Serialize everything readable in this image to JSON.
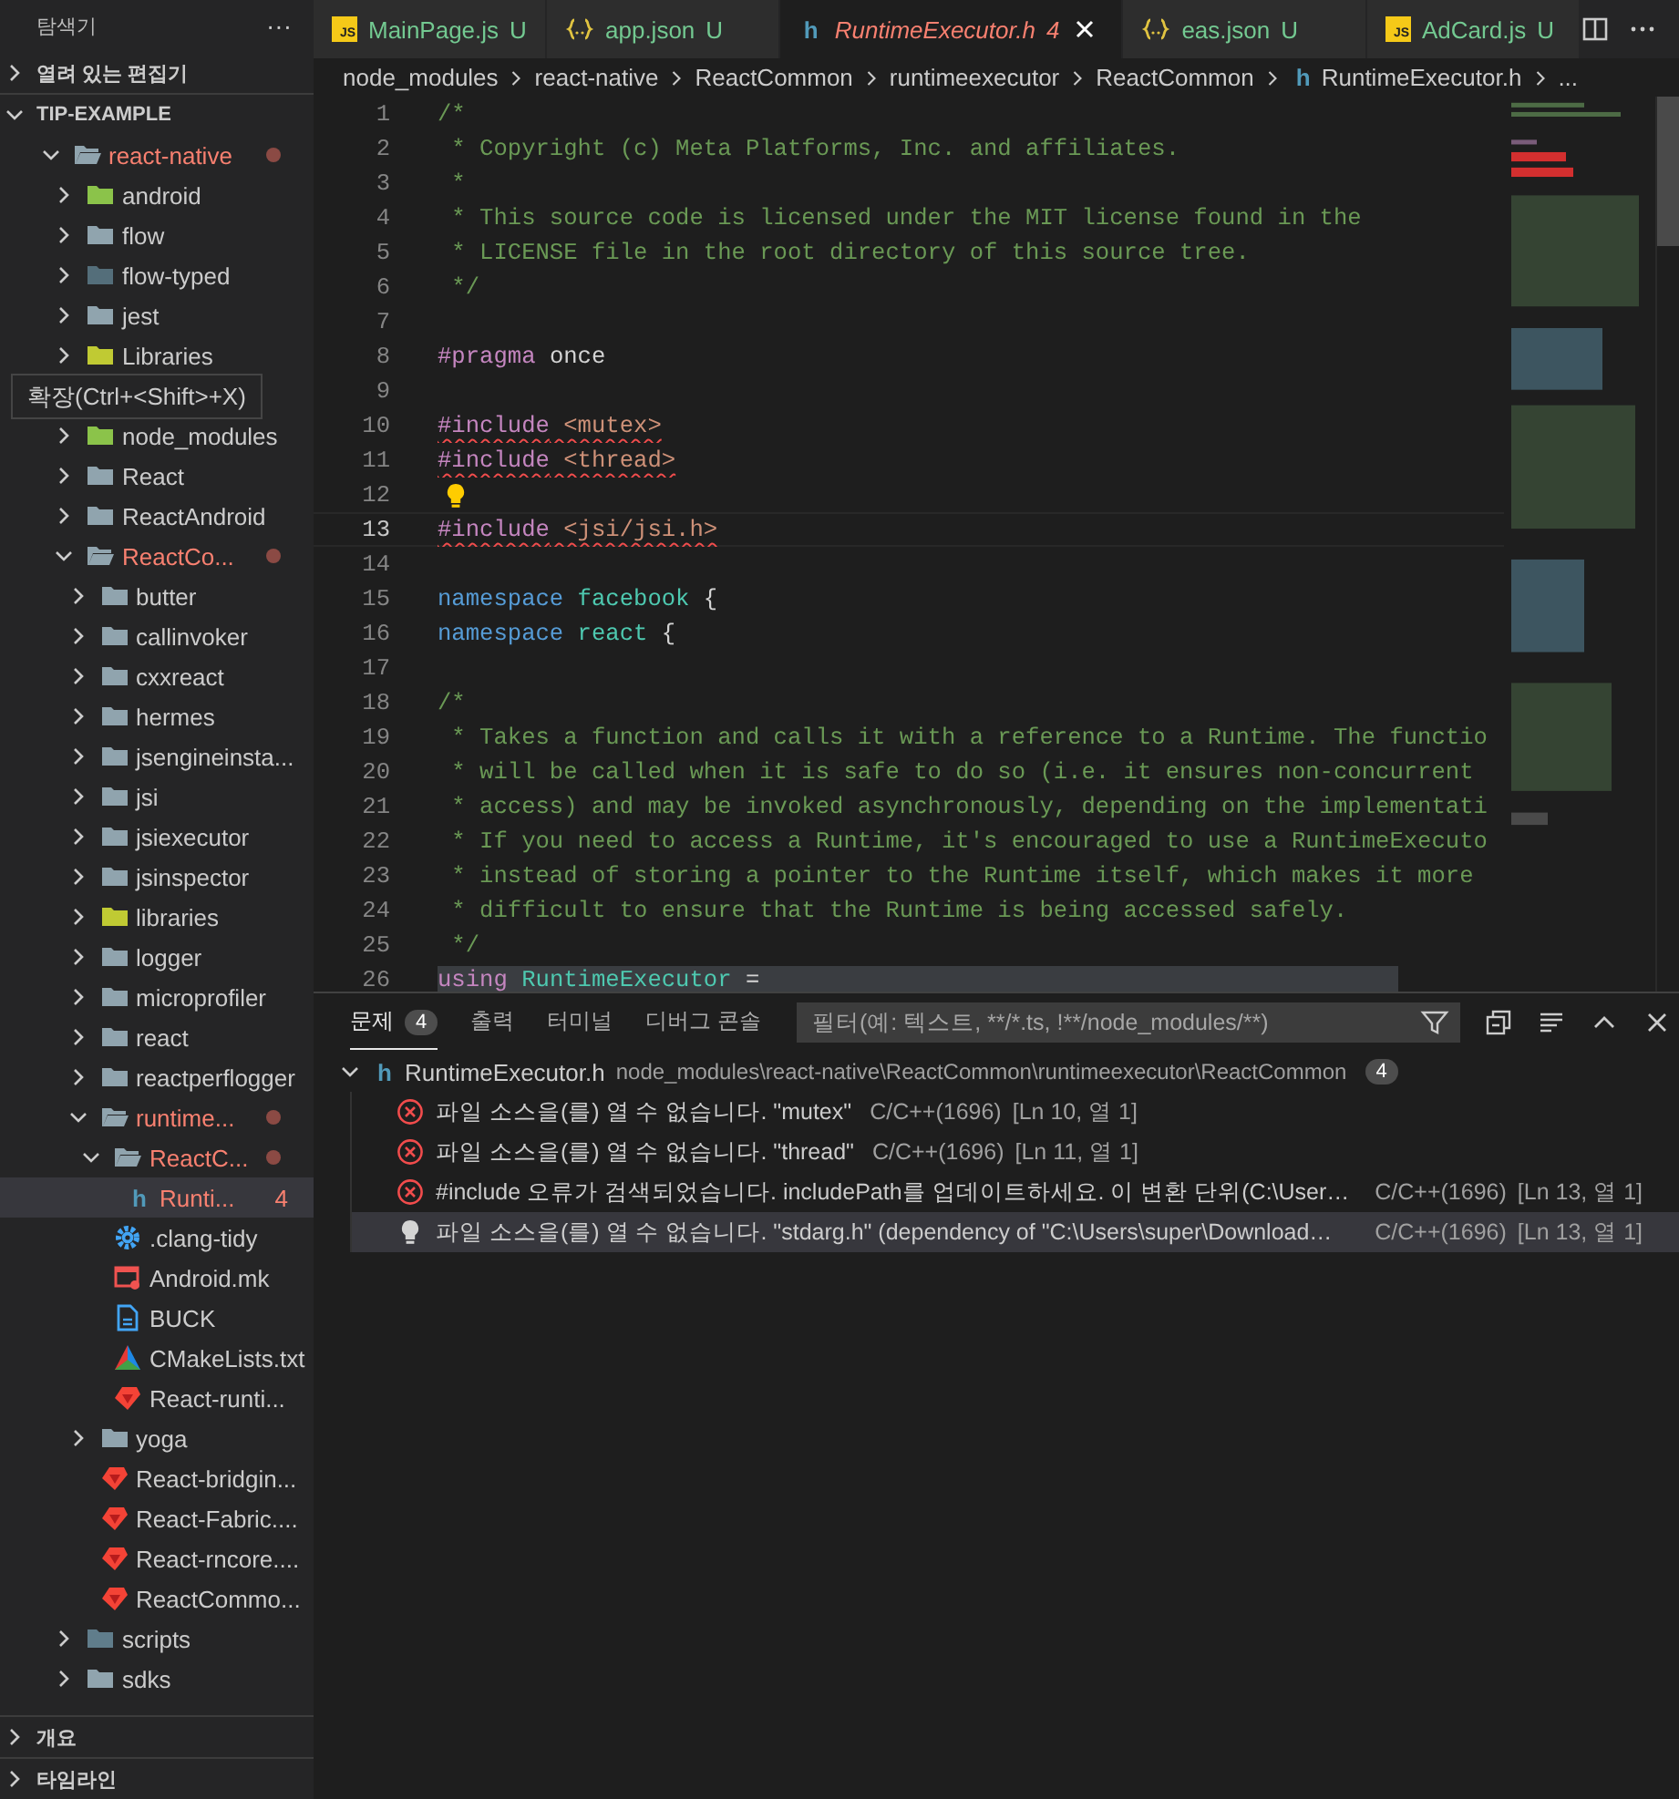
{
  "sidebar": {
    "title": "탐색기",
    "more": "···",
    "sections_top": [
      {
        "label": "열려 있는 편집기",
        "expanded": false
      }
    ],
    "workspace": {
      "label": "TIP-EXAMPLE",
      "expanded": true
    },
    "tree": [
      {
        "label": "react-native",
        "kind": "folder",
        "color": "#90a4ae",
        "expanded": true,
        "error": true,
        "selected": false,
        "children": [
          {
            "label": "android",
            "kind": "folder",
            "color": "#8bc34a",
            "expanded": false,
            "error": false,
            "selected": false
          },
          {
            "label": "flow",
            "kind": "folder",
            "color": "#90a4ae",
            "expanded": false,
            "error": false,
            "selected": false
          },
          {
            "label": "flow-typed",
            "kind": "folder",
            "color": "#546e7a",
            "expanded": false,
            "error": false,
            "selected": false
          },
          {
            "label": "jest",
            "kind": "folder",
            "color": "#90a4ae",
            "expanded": false,
            "error": false,
            "selected": false
          },
          {
            "label": "Libraries",
            "kind": "folder",
            "color": "#c0ca33",
            "expanded": false,
            "error": false,
            "selected": false
          },
          {
            "label": "확장(Ctrl+<Shift>+X)",
            "kind": "tooltip"
          },
          {
            "label": "node_modules",
            "kind": "folder",
            "color": "#8bc34a",
            "expanded": false,
            "error": false,
            "selected": false
          },
          {
            "label": "React",
            "kind": "folder",
            "color": "#90a4ae",
            "expanded": false,
            "error": false,
            "selected": false
          },
          {
            "label": "ReactAndroid",
            "kind": "folder",
            "color": "#90a4ae",
            "expanded": false,
            "error": false,
            "selected": false
          },
          {
            "label": "ReactCo...",
            "kind": "folder",
            "color": "#90a4ae",
            "expanded": true,
            "error": true,
            "selected": false,
            "children": [
              {
                "label": "butter",
                "kind": "folder",
                "color": "#90a4ae",
                "expanded": false,
                "error": false,
                "selected": false
              },
              {
                "label": "callinvoker",
                "kind": "folder",
                "color": "#90a4ae",
                "expanded": false,
                "error": false,
                "selected": false
              },
              {
                "label": "cxxreact",
                "kind": "folder",
                "color": "#90a4ae",
                "expanded": false,
                "error": false,
                "selected": false
              },
              {
                "label": "hermes",
                "kind": "folder",
                "color": "#90a4ae",
                "expanded": false,
                "error": false,
                "selected": false
              },
              {
                "label": "jsengineinsta...",
                "kind": "folder",
                "color": "#90a4ae",
                "expanded": false,
                "error": false,
                "selected": false
              },
              {
                "label": "jsi",
                "kind": "folder",
                "color": "#90a4ae",
                "expanded": false,
                "error": false,
                "selected": false
              },
              {
                "label": "jsiexecutor",
                "kind": "folder",
                "color": "#90a4ae",
                "expanded": false,
                "error": false,
                "selected": false
              },
              {
                "label": "jsinspector",
                "kind": "folder",
                "color": "#90a4ae",
                "expanded": false,
                "error": false,
                "selected": false
              },
              {
                "label": "libraries",
                "kind": "folder",
                "color": "#c0ca33",
                "expanded": false,
                "error": false,
                "selected": false
              },
              {
                "label": "logger",
                "kind": "folder",
                "color": "#90a4ae",
                "expanded": false,
                "error": false,
                "selected": false
              },
              {
                "label": "microprofiler",
                "kind": "folder",
                "color": "#90a4ae",
                "expanded": false,
                "error": false,
                "selected": false
              },
              {
                "label": "react",
                "kind": "folder",
                "color": "#90a4ae",
                "expanded": false,
                "error": false,
                "selected": false
              },
              {
                "label": "reactperflogger",
                "kind": "folder",
                "color": "#90a4ae",
                "expanded": false,
                "error": false,
                "selected": false
              },
              {
                "label": "runtime...",
                "kind": "folder",
                "color": "#90a4ae",
                "expanded": true,
                "error": true,
                "selected": false,
                "children": [
                  {
                    "label": "ReactC...",
                    "kind": "folder",
                    "color": "#90a4ae",
                    "expanded": true,
                    "error": true,
                    "selected": false,
                    "children": [
                      {
                        "label": "Runti...",
                        "kind": "header",
                        "icon_text": "h",
                        "error": true,
                        "badge": "4",
                        "selected": true
                      }
                    ]
                  },
                  {
                    "label": ".clang-tidy",
                    "kind": "gear",
                    "error": false,
                    "selected": false
                  },
                  {
                    "label": "Android.mk",
                    "kind": "make",
                    "error": false,
                    "selected": false
                  },
                  {
                    "label": "BUCK",
                    "kind": "doc",
                    "error": false,
                    "selected": false
                  },
                  {
                    "label": "CMakeLists.txt",
                    "kind": "cmake",
                    "error": false,
                    "selected": false
                  },
                  {
                    "label": "React-runti...",
                    "kind": "ruby",
                    "error": false,
                    "selected": false
                  }
                ]
              },
              {
                "label": "yoga",
                "kind": "folder",
                "color": "#90a4ae",
                "expanded": false,
                "error": false,
                "selected": false
              },
              {
                "label": "React-bridgin...",
                "kind": "ruby",
                "error": false,
                "selected": false
              },
              {
                "label": "React-Fabric....",
                "kind": "ruby",
                "error": false,
                "selected": false
              },
              {
                "label": "React-rncore....",
                "kind": "ruby",
                "error": false,
                "selected": false
              },
              {
                "label": "ReactCommo...",
                "kind": "ruby",
                "error": false,
                "selected": false
              }
            ]
          },
          {
            "label": "scripts",
            "kind": "folder",
            "color": "#607d8b",
            "expanded": false,
            "error": false,
            "selected": false
          },
          {
            "label": "sdks",
            "kind": "folder",
            "color": "#90a4ae",
            "expanded": false,
            "error": false,
            "selected": false
          }
        ]
      }
    ],
    "sections_bottom": [
      {
        "label": "개요",
        "expanded": false
      },
      {
        "label": "타임라인",
        "expanded": false
      }
    ]
  },
  "tabs": [
    {
      "label": "MainPage.js",
      "kind": "js",
      "icon_text": "JS",
      "status": "U",
      "error": false,
      "selected": false
    },
    {
      "label": "app.json",
      "kind": "json",
      "status": "U",
      "error": false,
      "selected": false
    },
    {
      "label": "RuntimeExecutor.h",
      "kind": "header",
      "icon_text": "h",
      "status": "4",
      "error": true,
      "selected": true
    },
    {
      "label": "eas.json",
      "kind": "json",
      "status": "U",
      "error": false,
      "selected": false
    },
    {
      "label": "AdCard.js",
      "kind": "js",
      "icon_text": "JS",
      "status": "U",
      "error": false,
      "selected": false
    }
  ],
  "breadcrumb": [
    {
      "label": "node_modules",
      "kind": "folder"
    },
    {
      "label": "react-native",
      "kind": "folder"
    },
    {
      "label": "ReactCommon",
      "kind": "folder"
    },
    {
      "label": "runtimeexecutor",
      "kind": "folder"
    },
    {
      "label": "ReactCommon",
      "kind": "folder"
    },
    {
      "label": "RuntimeExecutor.h",
      "kind": "header",
      "icon_text": "h"
    },
    {
      "label": "...",
      "kind": "more"
    }
  ],
  "code": [
    {
      "number": "1",
      "tokens": [
        {
          "t": "/*",
          "kind": "comment"
        }
      ]
    },
    {
      "number": "2",
      "tokens": [
        {
          "t": " * Copyright (c) Meta Platforms, Inc. and affiliates.",
          "kind": "comment"
        }
      ]
    },
    {
      "number": "3",
      "tokens": [
        {
          "t": " *",
          "kind": "comment"
        }
      ]
    },
    {
      "number": "4",
      "tokens": [
        {
          "t": " * This source code is licensed under the MIT license found in the",
          "kind": "comment"
        }
      ]
    },
    {
      "number": "5",
      "tokens": [
        {
          "t": " * LICENSE file in the root directory of this source tree.",
          "kind": "comment"
        }
      ]
    },
    {
      "number": "6",
      "tokens": [
        {
          "t": " */",
          "kind": "comment"
        }
      ]
    },
    {
      "number": "7"
    },
    {
      "number": "8",
      "tokens": [
        {
          "t": "#pragma",
          "kind": "directive"
        },
        {
          "t": " once",
          "kind": "plain"
        }
      ]
    },
    {
      "number": "9"
    },
    {
      "number": "10",
      "error": true,
      "tokens": [
        {
          "t": "#include",
          "kind": "directive"
        },
        {
          "t": " <mutex>",
          "kind": "string"
        }
      ]
    },
    {
      "number": "11",
      "error": true,
      "tokens": [
        {
          "t": "#include",
          "kind": "directive"
        },
        {
          "t": " <thread>",
          "kind": "string"
        }
      ]
    },
    {
      "number": "12",
      "lightbulb": true
    },
    {
      "number": "13",
      "error": true,
      "current": true,
      "tokens": [
        {
          "t": "#include",
          "kind": "directive"
        },
        {
          "t": " <jsi/jsi.h>",
          "kind": "string"
        }
      ]
    },
    {
      "number": "14"
    },
    {
      "number": "15",
      "tokens": [
        {
          "t": "namespace",
          "kind": "keyword"
        },
        {
          "t": " facebook",
          "kind": "type"
        },
        {
          "t": " {",
          "kind": "plain"
        }
      ]
    },
    {
      "number": "16",
      "tokens": [
        {
          "t": "namespace",
          "kind": "keyword"
        },
        {
          "t": " react",
          "kind": "type"
        },
        {
          "t": " {",
          "kind": "plain"
        }
      ]
    },
    {
      "number": "17"
    },
    {
      "number": "18",
      "tokens": [
        {
          "t": "/*",
          "kind": "comment"
        }
      ]
    },
    {
      "number": "19",
      "tokens": [
        {
          "t": " * Takes a function and calls it with a reference to a Runtime. The functio",
          "kind": "comment"
        }
      ]
    },
    {
      "number": "20",
      "tokens": [
        {
          "t": " * will be called when it is safe to do so (i.e. it ensures non-concurrent",
          "kind": "comment"
        }
      ]
    },
    {
      "number": "21",
      "tokens": [
        {
          "t": " * access) and may be invoked asynchronously, depending on the implementati",
          "kind": "comment"
        }
      ]
    },
    {
      "number": "22",
      "tokens": [
        {
          "t": " * If you need to access a Runtime, it's encouraged to use a RuntimeExecuto",
          "kind": "comment"
        }
      ]
    },
    {
      "number": "23",
      "tokens": [
        {
          "t": " * instead of storing a pointer to the Runtime itself, which makes it more",
          "kind": "comment"
        }
      ]
    },
    {
      "number": "24",
      "tokens": [
        {
          "t": " * difficult to ensure that the Runtime is being accessed safely.",
          "kind": "comment"
        }
      ]
    },
    {
      "number": "25",
      "tokens": [
        {
          "t": " */",
          "kind": "comment"
        }
      ]
    },
    {
      "number": "26",
      "highlight": true,
      "tokens": [
        {
          "t": "using",
          "kind": "control"
        },
        {
          "t": " RuntimeExecutor",
          "kind": "type"
        },
        {
          "t": " =",
          "kind": "plain"
        }
      ]
    }
  ],
  "panel": {
    "tabs": [
      {
        "label": "문제",
        "badge": "4",
        "selected": true
      },
      {
        "label": "출력",
        "selected": false
      },
      {
        "label": "터미널",
        "selected": false
      },
      {
        "label": "디버그 콘솔",
        "selected": false
      }
    ],
    "filter": {
      "placeholder": "필터(예: 텍스트, **/*.ts, !**/node_modules/**)"
    },
    "file": {
      "icon_text": "h",
      "name": "RuntimeExecutor.h",
      "path": "node_modules\\react-native\\ReactCommon\\runtimeexecutor\\ReactCommon",
      "count": "4",
      "expanded": true
    },
    "problems": [
      {
        "kind": "error",
        "message": "파일 소스을(를) 열 수 없습니다. \"mutex\"",
        "source": "C/C++(1696)",
        "location": "[Ln 10, 열 1]",
        "selected": false
      },
      {
        "kind": "error",
        "message": "파일 소스을(를) 열 수 없습니다. \"thread\"",
        "source": "C/C++(1696)",
        "location": "[Ln 11, 열 1]",
        "selected": false
      },
      {
        "kind": "error",
        "message": "#include 오류가 검색되었습니다. includePath를 업데이트하세요. 이 변환 단위(C:\\User…",
        "source": "C/C++(1696)",
        "location": "[Ln 13, 열 1]",
        "selected": false
      },
      {
        "kind": "fix",
        "message": "파일 소스을(를) 열 수 없습니다. \"stdarg.h\" (dependency of \"C:\\Users\\super\\Download…",
        "source": "C/C++(1696)",
        "location": "[Ln 13, 열 1]",
        "selected": true
      }
    ]
  }
}
